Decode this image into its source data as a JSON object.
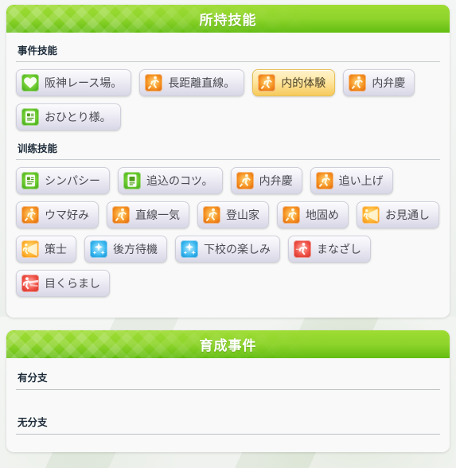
{
  "page": {
    "background_color": "#f2f4f3",
    "accent_green": "#8ed42b"
  },
  "skills_card": {
    "header": {
      "title": "所持技能",
      "icon": "diamond-lattice-pattern"
    },
    "sections": [
      {
        "id": "event-skills",
        "title": "事件技能",
        "badges": [
          {
            "label": "阪神レース場。",
            "icon": "heart-skill-icon",
            "icon_color": "green",
            "glyph": "heart",
            "highlight": false
          },
          {
            "label": "長距離直線。",
            "icon": "runner-skill-icon",
            "icon_color": "orange",
            "glyph": "runner",
            "highlight": false
          },
          {
            "label": "内的体験",
            "icon": "runner-skill-icon",
            "icon_color": "orange",
            "glyph": "runner",
            "highlight": true
          },
          {
            "label": "内弁慶",
            "icon": "runner-skill-icon",
            "icon_color": "orange",
            "glyph": "runner",
            "highlight": false
          },
          {
            "label": "おひとり様。",
            "icon": "note-skill-icon",
            "icon_color": "green",
            "glyph": "note",
            "highlight": false
          }
        ]
      },
      {
        "id": "training-skills",
        "title": "训练技能",
        "badges": [
          {
            "label": "シンパシー",
            "icon": "note-skill-icon",
            "icon_color": "green",
            "glyph": "note",
            "highlight": false
          },
          {
            "label": "追込のコツ。",
            "icon": "book-skill-icon",
            "icon_color": "green",
            "glyph": "book",
            "highlight": false
          },
          {
            "label": "内弁慶",
            "icon": "runner-skill-icon",
            "icon_color": "orange",
            "glyph": "runner",
            "highlight": false
          },
          {
            "label": "追い上げ",
            "icon": "runner-skill-icon",
            "icon_color": "orange",
            "glyph": "runner",
            "highlight": false
          },
          {
            "label": "ウマ好み",
            "icon": "runner-skill-icon",
            "icon_color": "orange",
            "glyph": "runner",
            "highlight": false
          },
          {
            "label": "直線一気",
            "icon": "runner-skill-icon",
            "icon_color": "orange",
            "glyph": "runner",
            "highlight": false
          },
          {
            "label": "登山家",
            "icon": "runner-skill-icon",
            "icon_color": "orange",
            "glyph": "runner",
            "highlight": false
          },
          {
            "label": "地固め",
            "icon": "runner-skill-icon",
            "icon_color": "orange",
            "glyph": "runner",
            "highlight": false
          },
          {
            "label": "お見通し",
            "icon": "spotlight-skill-icon",
            "icon_color": "yellow",
            "glyph": "cone",
            "highlight": false
          },
          {
            "label": "策士",
            "icon": "spotlight-skill-icon",
            "icon_color": "yellow",
            "glyph": "cone",
            "highlight": false
          },
          {
            "label": "後方待機",
            "icon": "sparkle-skill-icon",
            "icon_color": "blue",
            "glyph": "sparkle",
            "highlight": false
          },
          {
            "label": "下校の楽しみ",
            "icon": "sparkle-skill-icon",
            "icon_color": "blue",
            "glyph": "sparkle",
            "highlight": false
          },
          {
            "label": "まなざし",
            "icon": "gaze-skill-icon",
            "icon_color": "red",
            "glyph": "gaze",
            "highlight": false
          },
          {
            "label": "目くらまし",
            "icon": "flash-skill-icon",
            "icon_color": "red",
            "glyph": "flash",
            "highlight": false
          }
        ]
      }
    ]
  },
  "events_card": {
    "header": {
      "title": "育成事件",
      "icon": "diamond-lattice-pattern"
    },
    "rows": [
      {
        "label": "有分支"
      },
      {
        "label": "无分支"
      }
    ]
  }
}
